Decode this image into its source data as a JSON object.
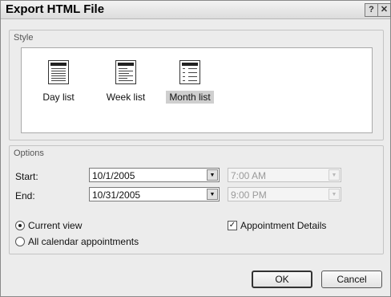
{
  "window": {
    "title": "Export HTML File",
    "help_glyph": "?",
    "close_glyph": "✕"
  },
  "style_group": {
    "label": "Style",
    "items": [
      {
        "label": "Day list",
        "icon": "day-list-icon",
        "selected": false
      },
      {
        "label": "Week list",
        "icon": "week-list-icon",
        "selected": false
      },
      {
        "label": "Month list",
        "icon": "month-list-icon",
        "selected": true
      }
    ]
  },
  "options_group": {
    "label": "Options",
    "start": {
      "label": "Start:",
      "date": "10/1/2005",
      "time": "7:00 AM",
      "time_enabled": false
    },
    "end": {
      "label": "End:",
      "date": "10/31/2005",
      "time": "9:00 PM",
      "time_enabled": false
    },
    "view_options": [
      {
        "label": "Current view",
        "checked": true
      },
      {
        "label": "All calendar appointments",
        "checked": false
      }
    ],
    "appointment_details": {
      "label": "Appointment Details",
      "checked": true
    }
  },
  "buttons": {
    "ok": "OK",
    "cancel": "Cancel"
  },
  "glyphs": {
    "arrow_down": "▼",
    "check": "✓"
  }
}
